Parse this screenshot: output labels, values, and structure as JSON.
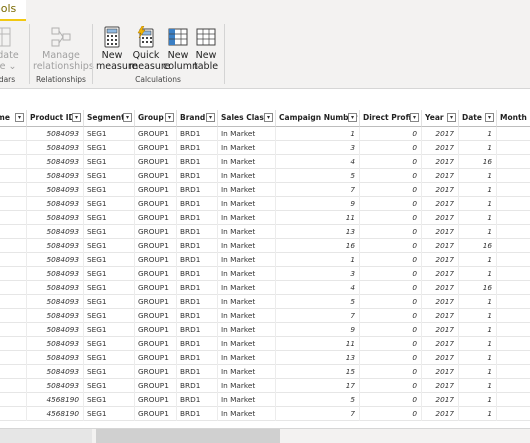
{
  "ribbon": {
    "active_tab": "ools",
    "colors": {
      "accent": "#f2c811"
    },
    "calendars": {
      "button_line1": "s date",
      "button_line2": "e ⌄",
      "group_label": "dars"
    },
    "relationships": {
      "button_line1": "Manage",
      "button_line2": "relationships",
      "group_label": "Relationships"
    },
    "calculations": {
      "group_label": "Calculations",
      "buttons": [
        {
          "line1": "New",
          "line2": "measure",
          "icon": "calculator-icon"
        },
        {
          "line1": "Quick",
          "line2": "measure",
          "icon": "quick-measure-icon"
        },
        {
          "line1": "New",
          "line2": "column",
          "icon": "new-column-icon"
        },
        {
          "line1": "New",
          "line2": "table",
          "icon": "new-table-icon"
        }
      ]
    }
  },
  "table": {
    "columns": [
      "me",
      "Product ID",
      "Segment",
      "Group",
      "Brand",
      "Sales Class",
      "Campaign Number",
      "Direct Profit",
      "Year",
      "Date",
      "Month"
    ],
    "rows": [
      [
        "",
        "5084093",
        "SEG1",
        "GROUP1",
        "BRD1",
        "In Market",
        "1",
        "0",
        "2017",
        "1",
        ""
      ],
      [
        "",
        "5084093",
        "SEG1",
        "GROUP1",
        "BRD1",
        "In Market",
        "3",
        "0",
        "2017",
        "1",
        ""
      ],
      [
        "",
        "5084093",
        "SEG1",
        "GROUP1",
        "BRD1",
        "In Market",
        "4",
        "0",
        "2017",
        "16",
        ""
      ],
      [
        "",
        "5084093",
        "SEG1",
        "GROUP1",
        "BRD1",
        "In Market",
        "5",
        "0",
        "2017",
        "1",
        ""
      ],
      [
        "",
        "5084093",
        "SEG1",
        "GROUP1",
        "BRD1",
        "In Market",
        "7",
        "0",
        "2017",
        "1",
        ""
      ],
      [
        "",
        "5084093",
        "SEG1",
        "GROUP1",
        "BRD1",
        "In Market",
        "9",
        "0",
        "2017",
        "1",
        ""
      ],
      [
        "",
        "5084093",
        "SEG1",
        "GROUP1",
        "BRD1",
        "In Market",
        "11",
        "0",
        "2017",
        "1",
        ""
      ],
      [
        "",
        "5084093",
        "SEG1",
        "GROUP1",
        "BRD1",
        "In Market",
        "13",
        "0",
        "2017",
        "1",
        ""
      ],
      [
        "",
        "5084093",
        "SEG1",
        "GROUP1",
        "BRD1",
        "In Market",
        "16",
        "0",
        "2017",
        "16",
        ""
      ],
      [
        "",
        "5084093",
        "SEG1",
        "GROUP1",
        "BRD1",
        "In Market",
        "1",
        "0",
        "2017",
        "1",
        ""
      ],
      [
        "",
        "5084093",
        "SEG1",
        "GROUP1",
        "BRD1",
        "In Market",
        "3",
        "0",
        "2017",
        "1",
        ""
      ],
      [
        "",
        "5084093",
        "SEG1",
        "GROUP1",
        "BRD1",
        "In Market",
        "4",
        "0",
        "2017",
        "16",
        ""
      ],
      [
        "",
        "5084093",
        "SEG1",
        "GROUP1",
        "BRD1",
        "In Market",
        "5",
        "0",
        "2017",
        "1",
        ""
      ],
      [
        "",
        "5084093",
        "SEG1",
        "GROUP1",
        "BRD1",
        "In Market",
        "7",
        "0",
        "2017",
        "1",
        ""
      ],
      [
        "",
        "5084093",
        "SEG1",
        "GROUP1",
        "BRD1",
        "In Market",
        "9",
        "0",
        "2017",
        "1",
        ""
      ],
      [
        "",
        "5084093",
        "SEG1",
        "GROUP1",
        "BRD1",
        "In Market",
        "11",
        "0",
        "2017",
        "1",
        ""
      ],
      [
        "",
        "5084093",
        "SEG1",
        "GROUP1",
        "BRD1",
        "In Market",
        "13",
        "0",
        "2017",
        "1",
        ""
      ],
      [
        "",
        "5084093",
        "SEG1",
        "GROUP1",
        "BRD1",
        "In Market",
        "15",
        "0",
        "2017",
        "1",
        ""
      ],
      [
        "",
        "5084093",
        "SEG1",
        "GROUP1",
        "BRD1",
        "In Market",
        "17",
        "0",
        "2017",
        "1",
        ""
      ],
      [
        "",
        "4568190",
        "SEG1",
        "GROUP1",
        "BRD1",
        "In Market",
        "5",
        "0",
        "2017",
        "1",
        ""
      ],
      [
        "",
        "4568190",
        "SEG1",
        "GROUP1",
        "BRD1",
        "In Market",
        "7",
        "0",
        "2017",
        "1",
        ""
      ]
    ]
  }
}
